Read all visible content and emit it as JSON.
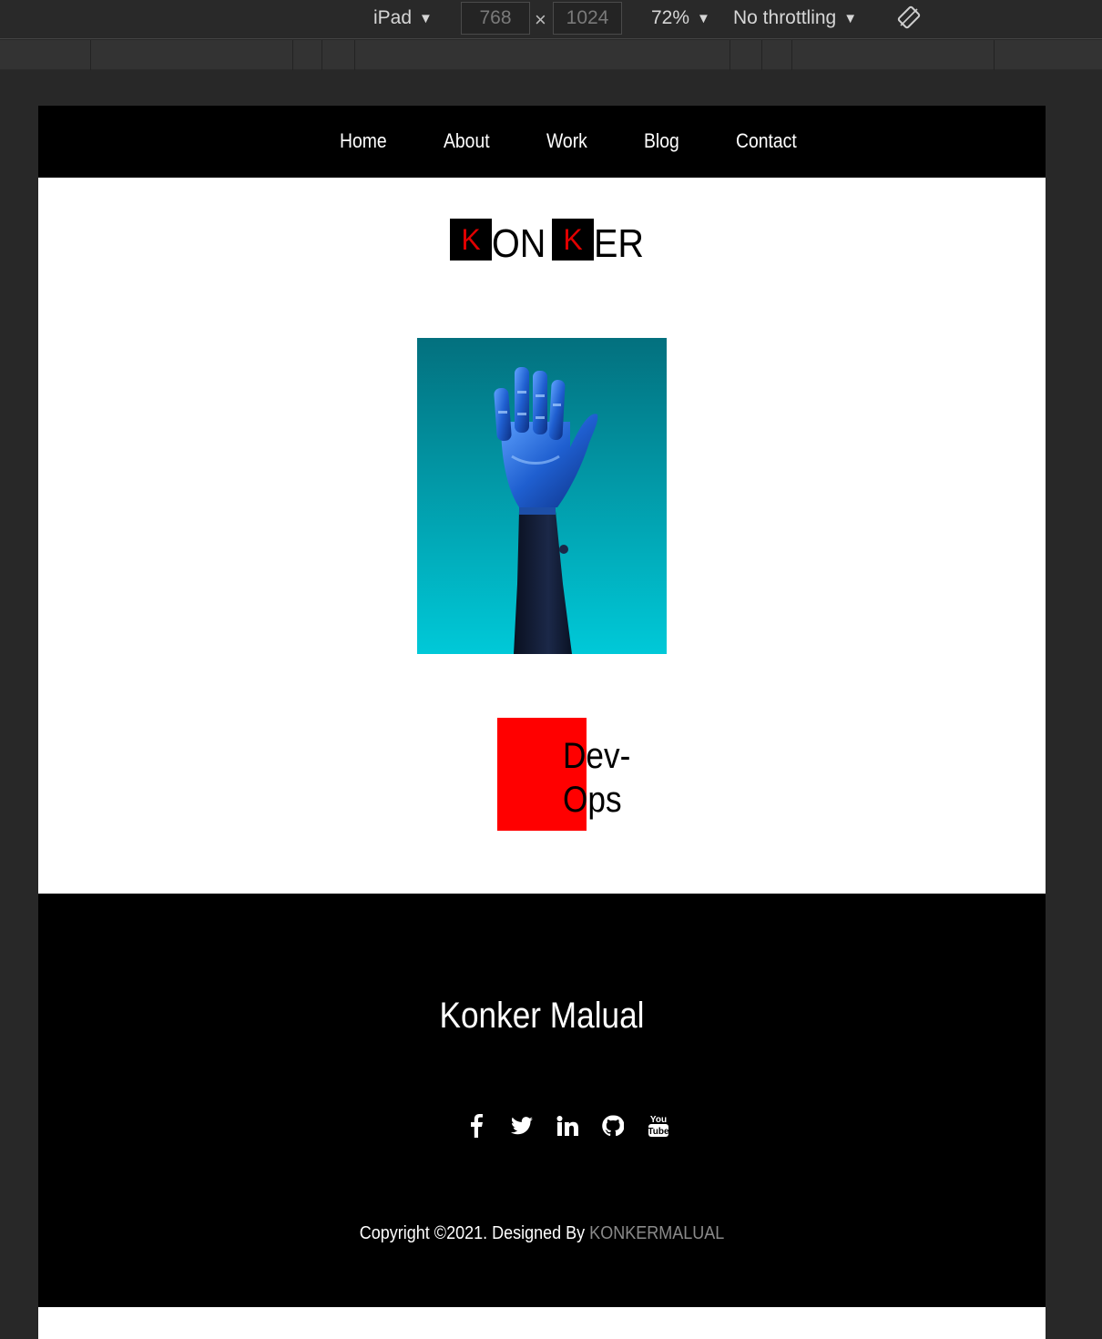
{
  "devtools": {
    "device": "iPad",
    "width": "768",
    "height": "1024",
    "zoom": "72%",
    "throttling": "No throttling",
    "times_symbol": "×"
  },
  "nav": {
    "items": [
      "Home",
      "About",
      "Work",
      "Blog",
      "Contact"
    ]
  },
  "logo": {
    "letter1": "K",
    "mid": "ON",
    "letter2": "K",
    "end": "ER"
  },
  "hero": {
    "image": "robotic-hand-image"
  },
  "devops": {
    "line1": "Dev-",
    "line2": "Ops"
  },
  "footer": {
    "name": "Konker Malual",
    "social": [
      "facebook-icon",
      "twitter-icon",
      "linkedin-icon",
      "github-icon",
      "youtube-icon"
    ],
    "copyright": "Copyright ©2021. Designed By",
    "brand": "KONKERMALUAL"
  },
  "colors": {
    "accent": "#ff0000",
    "logo_letter": "#e00000",
    "brand_link": "#8a8a8a",
    "hero_top": "#03707e",
    "hero_bottom": "#00c9d8"
  }
}
